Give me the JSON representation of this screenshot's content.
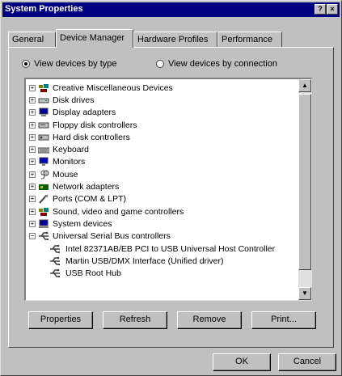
{
  "window": {
    "title": "System Properties"
  },
  "titlebar_buttons": {
    "help": "?",
    "close": "×"
  },
  "tabs": [
    {
      "label": "General"
    },
    {
      "label": "Device Manager"
    },
    {
      "label": "Hardware Profiles"
    },
    {
      "label": "Performance"
    }
  ],
  "view_options": {
    "by_type": "View devices by type",
    "by_connection": "View devices by connection",
    "selected": "by_type"
  },
  "devices": [
    {
      "label": "Creative Miscellaneous Devices",
      "icon": "misc-device-icon",
      "expander": "+"
    },
    {
      "label": "Disk drives",
      "icon": "disk-drive-icon",
      "expander": "+"
    },
    {
      "label": "Display adapters",
      "icon": "display-adapter-icon",
      "expander": "+"
    },
    {
      "label": "Floppy disk controllers",
      "icon": "floppy-controller-icon",
      "expander": "+"
    },
    {
      "label": "Hard disk controllers",
      "icon": "hard-disk-controller-icon",
      "expander": "+"
    },
    {
      "label": "Keyboard",
      "icon": "keyboard-icon",
      "expander": "+"
    },
    {
      "label": "Monitors",
      "icon": "monitor-icon",
      "expander": "+"
    },
    {
      "label": "Mouse",
      "icon": "mouse-icon",
      "expander": "+"
    },
    {
      "label": "Network adapters",
      "icon": "network-adapter-icon",
      "expander": "+"
    },
    {
      "label": "Ports (COM & LPT)",
      "icon": "port-icon",
      "expander": "+"
    },
    {
      "label": "Sound, video and game controllers",
      "icon": "sound-controller-icon",
      "expander": "+"
    },
    {
      "label": "System devices",
      "icon": "system-device-icon",
      "expander": "+"
    },
    {
      "label": "Universal Serial Bus controllers",
      "icon": "usb-icon",
      "expander": "−"
    }
  ],
  "usb_children": [
    {
      "label": "Intel 82371AB/EB PCI to USB Universal Host Controller",
      "icon": "usb-icon"
    },
    {
      "label": "Martin USB/DMX Interface (Unified driver)",
      "icon": "usb-icon"
    },
    {
      "label": "USB Root Hub",
      "icon": "usb-icon"
    }
  ],
  "scrollbar": {
    "up_arrow": "▲",
    "down_arrow": "▼"
  },
  "buttons": {
    "properties": "Properties",
    "refresh": "Refresh",
    "remove": "Remove",
    "print": "Print...",
    "ok": "OK",
    "cancel": "Cancel"
  },
  "colors": {
    "titlebar": "#000080",
    "face": "#c0c0c0",
    "usb_icon": "#404040"
  }
}
